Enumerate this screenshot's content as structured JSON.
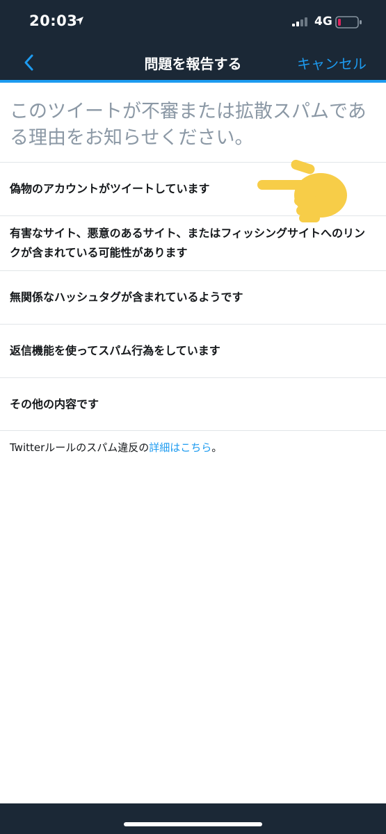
{
  "status_bar": {
    "time": "20:03",
    "network": "4G"
  },
  "nav": {
    "title": "問題を報告する",
    "cancel_label": "キャンセル"
  },
  "prompt": "このツイートが不審または拡散スパムである理由をお知らせください。",
  "options": [
    "偽物のアカウントがツイートしています",
    "有害なサイト、悪意のあるサイト、またはフィッシングサイトへのリンクが含まれている可能性があります",
    "無関係なハッシュタグが含まれているようです",
    "返信機能を使ってスパム行為をしています",
    "その他の内容です"
  ],
  "footer": {
    "text": "Twitterルールのスパム違反の",
    "link": "詳細はこちら",
    "end": "。"
  },
  "colors": {
    "header_bg": "#1b2836",
    "accent": "#1d9bf0",
    "battery_low": "#e0245e"
  }
}
